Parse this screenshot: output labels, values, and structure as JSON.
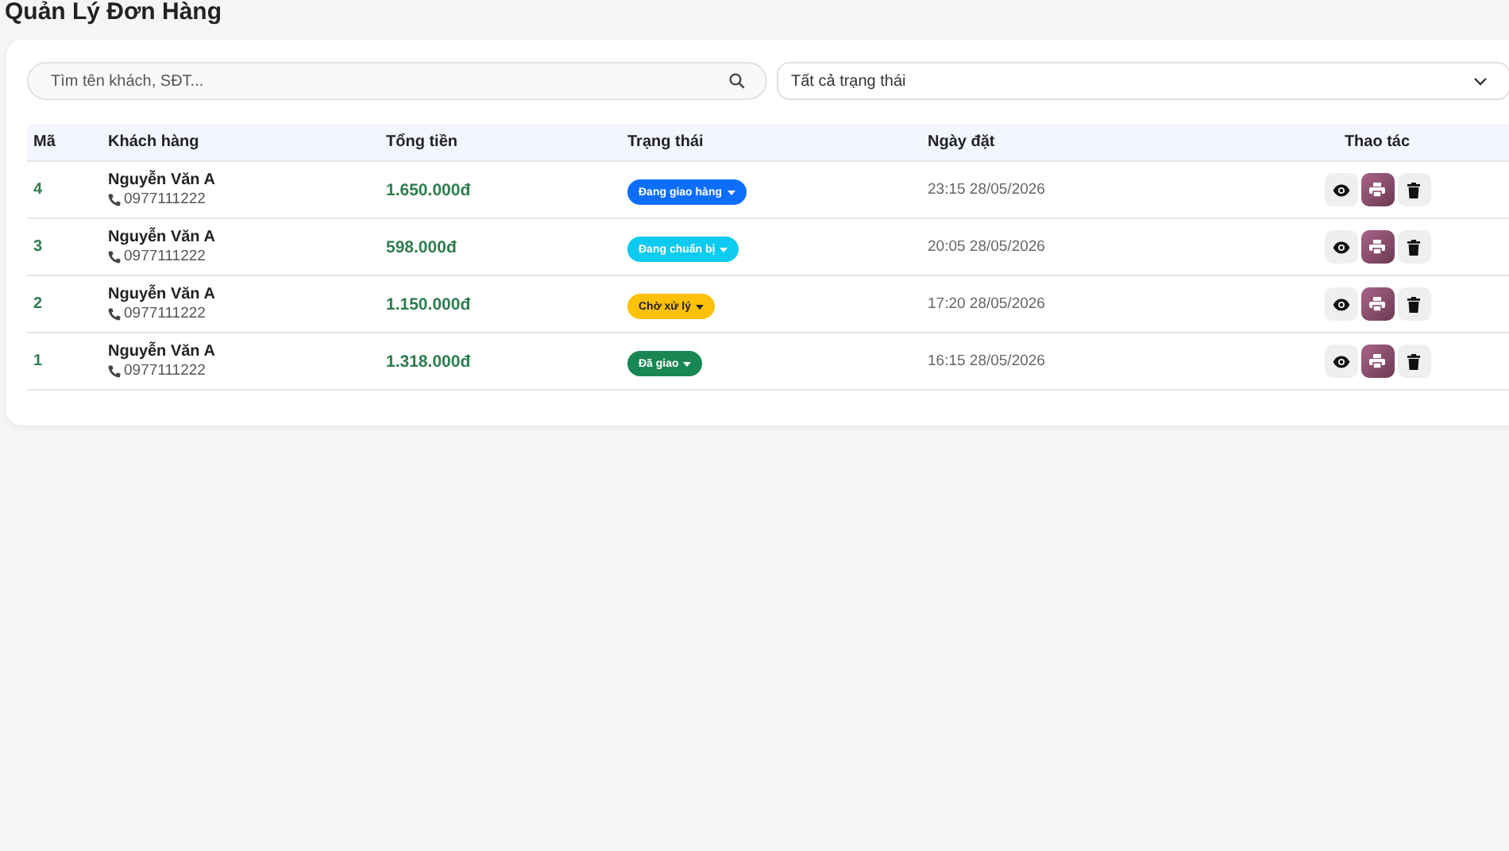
{
  "title": "Quản Lý Đơn Hàng",
  "search": {
    "placeholder": "Tìm tên khách, SĐT..."
  },
  "status_filter": {
    "value": "Tất cả trạng thái"
  },
  "table": {
    "columns": [
      "Mã",
      "Khách hàng",
      "Tổng tiền",
      "Trạng thái",
      "Ngày đặt",
      "Thao tác"
    ],
    "rows": [
      {
        "id": "4",
        "customer": "Nguyễn Văn A",
        "phone": "0977111222",
        "total": "1.650.000đ",
        "status": {
          "label": "Đang giao hàng",
          "color": "#0d6efd"
        },
        "date": "23:15 28/05/2026"
      },
      {
        "id": "3",
        "customer": "Nguyễn Văn A",
        "phone": "0977111222",
        "total": "598.000đ",
        "status": {
          "label": "Đang chuẩn bị",
          "color": "#0dcaf0"
        },
        "date": "20:05 28/05/2026"
      },
      {
        "id": "2",
        "customer": "Nguyễn Văn A",
        "phone": "0977111222",
        "total": "1.150.000đ",
        "status": {
          "label": "Chờ xử lý",
          "color": "#ffc107"
        },
        "date": "17:20 28/05/2026"
      },
      {
        "id": "1",
        "customer": "Nguyễn Văn A",
        "phone": "0977111222",
        "total": "1.318.000đ",
        "status": {
          "label": "Đã giao",
          "color": "#198754"
        },
        "date": "16:15 28/05/2026"
      }
    ]
  }
}
